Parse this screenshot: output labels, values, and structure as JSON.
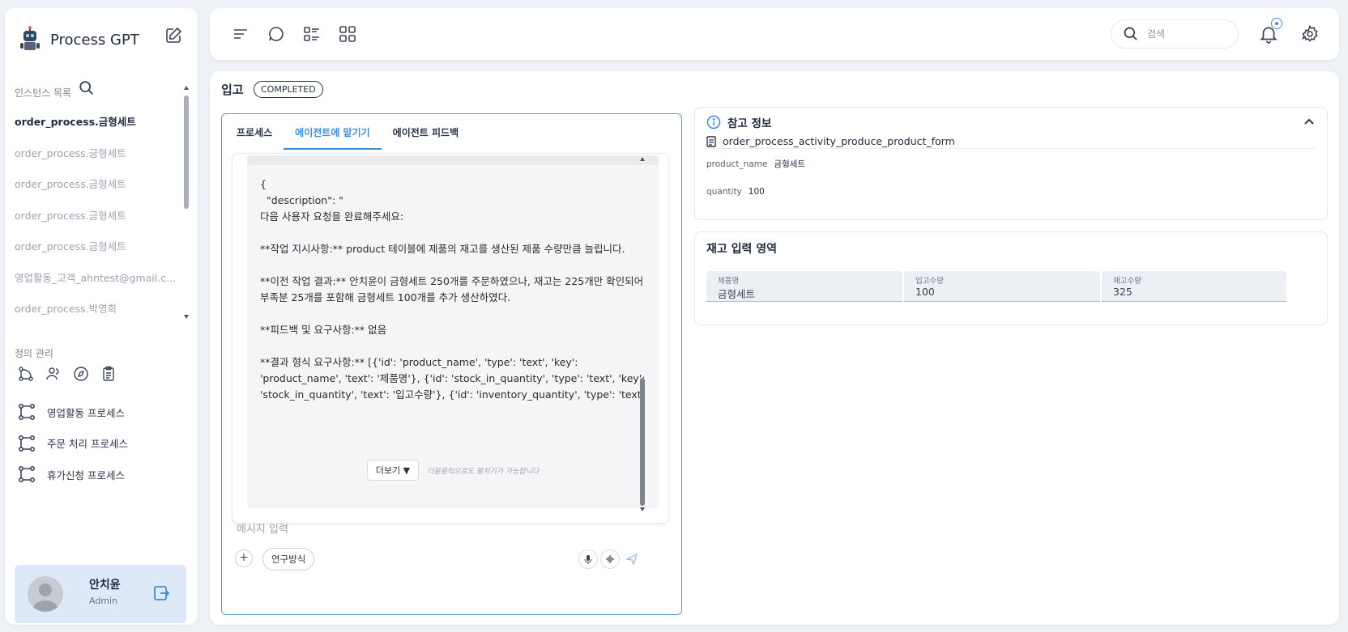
{
  "app": {
    "name": "Process GPT"
  },
  "sidebar": {
    "instances_label": "인스턴스 목록",
    "instances": [
      "order_process.금형세트",
      "order_process.금형세트",
      "order_process.금형세트",
      "order_process.금형세트",
      "order_process.금형세트",
      "영업활동_고객_ahntest@gmail.c...",
      "order_process.박영희"
    ],
    "definitions_label": "정의 관리",
    "processes": [
      "영업활동 프로세스",
      "주문 처리 프로세스",
      "휴가신청 프로세스"
    ],
    "user": {
      "name": "안치윤",
      "role": "Admin"
    }
  },
  "topbar": {
    "search_placeholder": "검색"
  },
  "page": {
    "title": "입고",
    "status": "COMPLETED"
  },
  "tabs": [
    "프로세스",
    "에이전트에 맡기기",
    "에이전트 피드백"
  ],
  "message": {
    "text": "{\n  \"description\": \"\n다음 사용자 요청을 완료해주세요:\n\n**작업 지시사항:** product 테이블에 제품의 재고를 생산된 제품 수량만큼 늘립니다.\n\n**이전 작업 결과:** 안치윤이 금형세트 250개를 주문하였으나, 재고는 225개만 확인되어 부족분 25개를 포함해 금형세트 100개를 추가 생산하였다.\n\n**피드백 및 요구사항:** 없음\n\n**결과 형식 요구사항:** [{'id': 'product_name', 'type': 'text', 'key': 'product_name', 'text': '제품명'}, {'id': 'stock_in_quantity', 'type': 'text', 'key': 'stock_in_quantity', 'text': '입고수량'}, {'id': 'inventory_quantity', 'type': 'text'",
    "more_label": "더보기 ▼",
    "more_hint": "더블클릭으로도 펼치기가 가능합니다"
  },
  "composer": {
    "placeholder": "메시지 입력",
    "mode_label": "연구방식"
  },
  "reference": {
    "title": "참고 정보",
    "form_id": "order_process_activity_produce_product_form",
    "fields": [
      {
        "key": "product_name",
        "value": "금형세트"
      },
      {
        "key": "quantity",
        "value": "100"
      }
    ]
  },
  "stock": {
    "title": "재고 입력 영역",
    "fields": [
      {
        "label": "제품명",
        "value": "금형세트"
      },
      {
        "label": "입고수량",
        "value": "100"
      },
      {
        "label": "재고수량",
        "value": "325"
      }
    ]
  },
  "colors": {
    "accent": "#3d8fd8",
    "panel_border": "#5b9bd5",
    "user_card": "#dde9f8"
  }
}
